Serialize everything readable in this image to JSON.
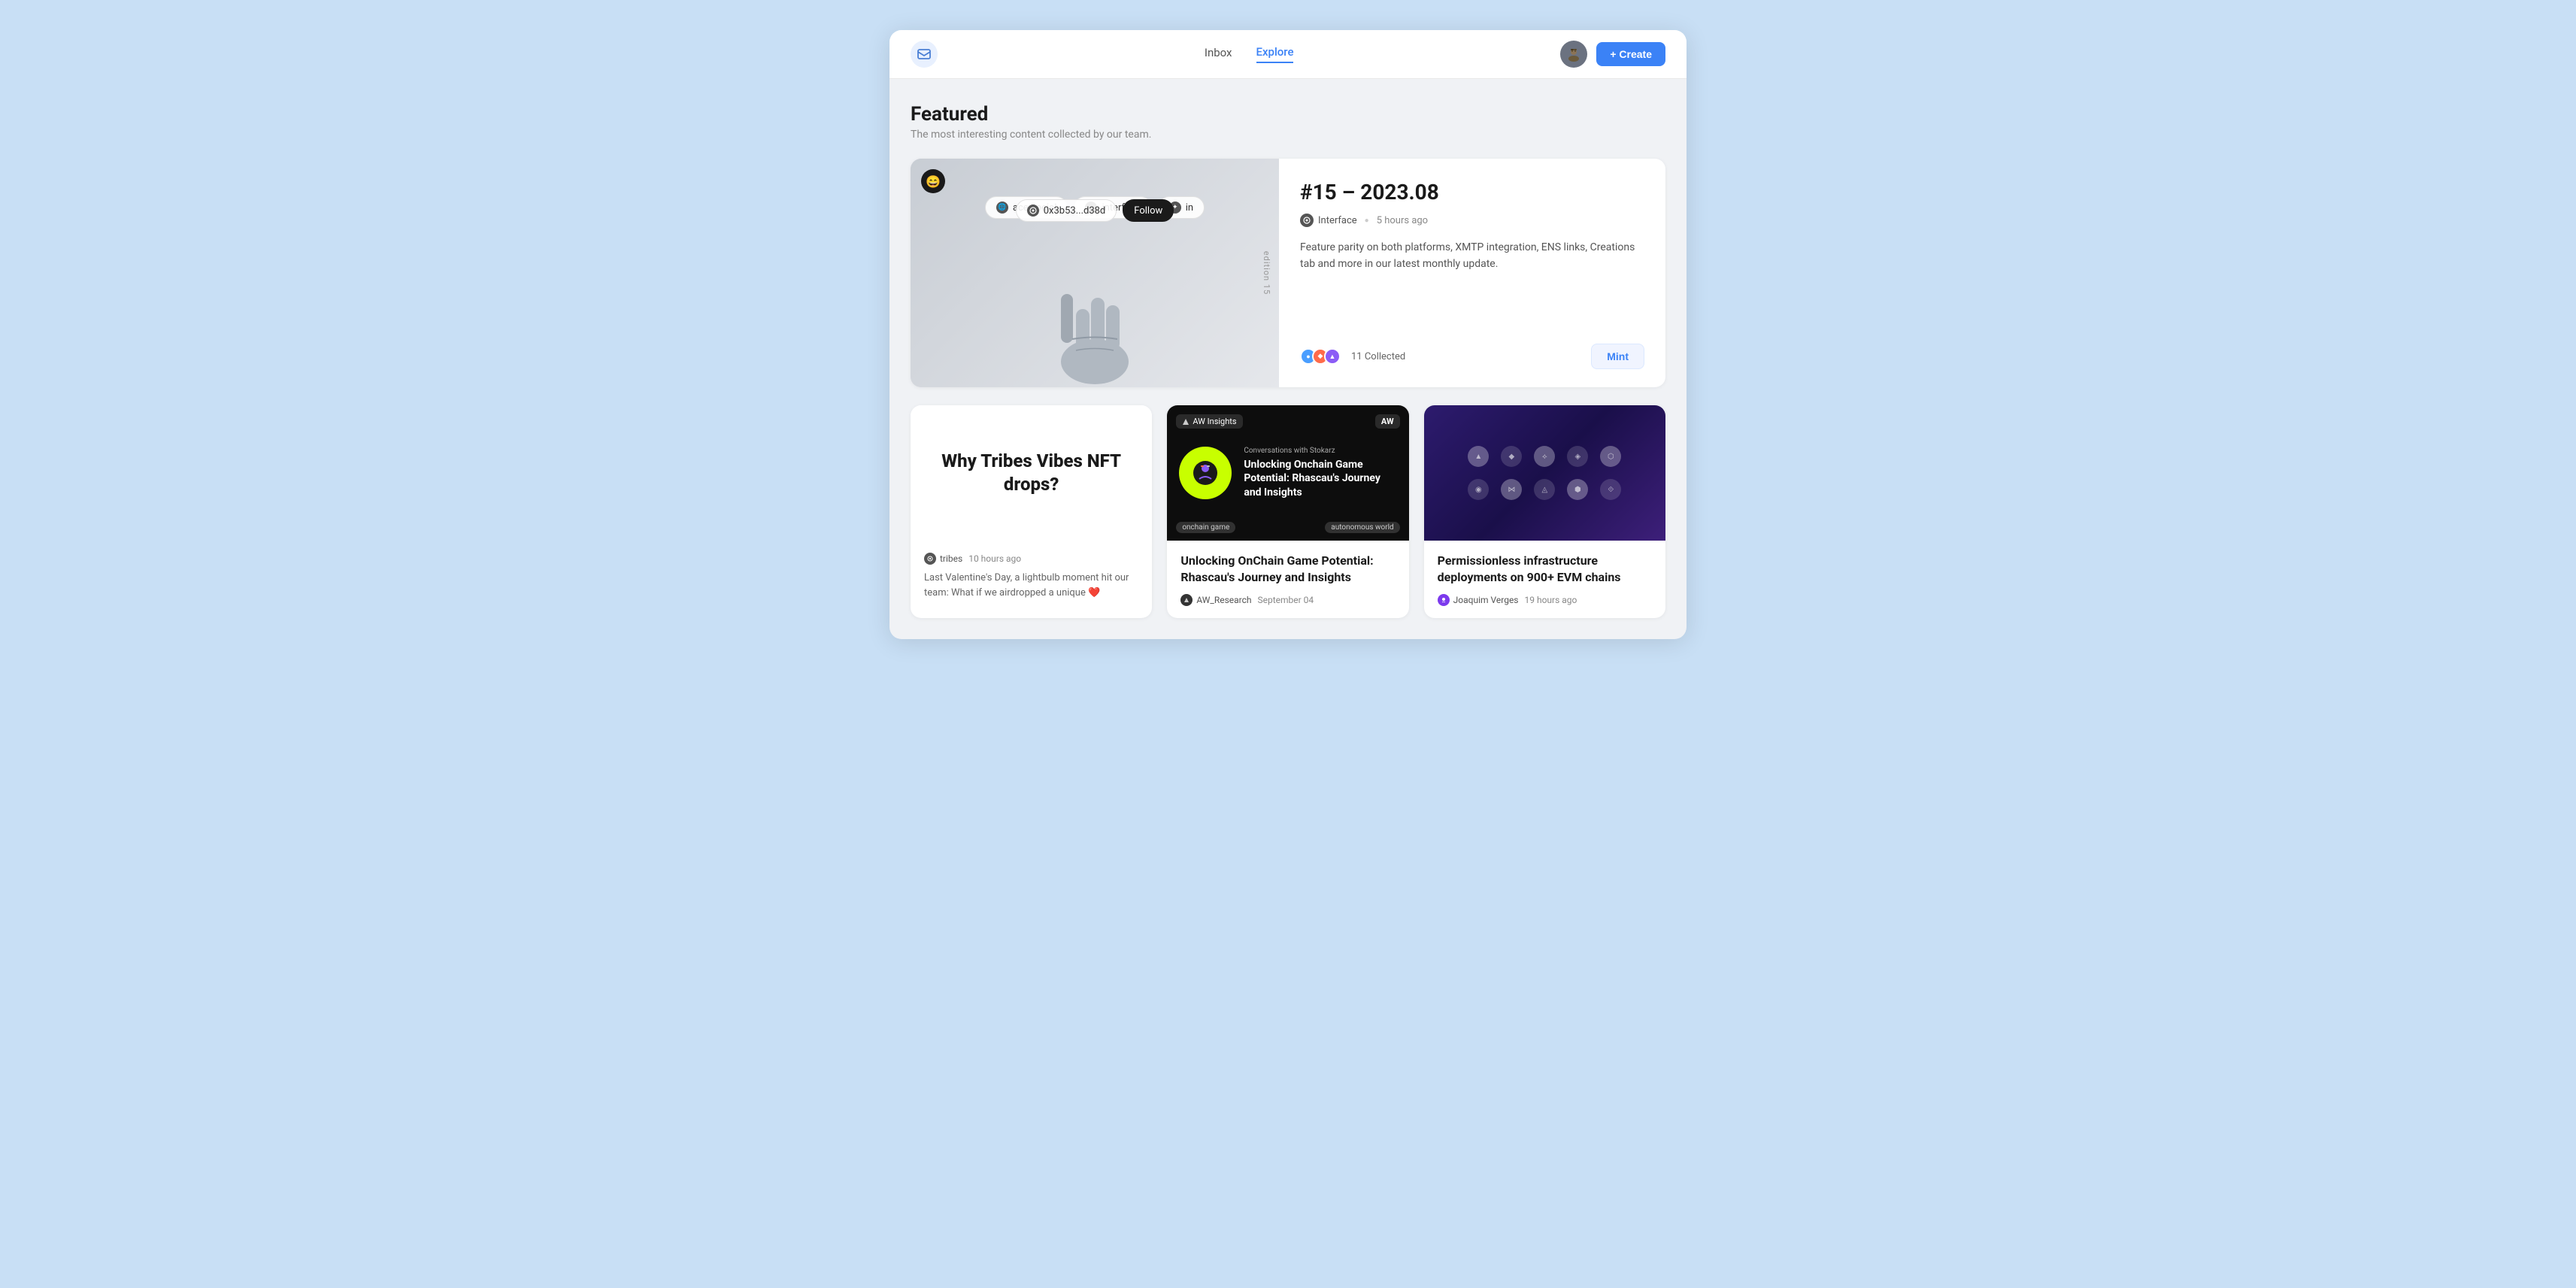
{
  "app": {
    "logo": "📬",
    "nav": {
      "inbox": "Inbox",
      "explore": "Explore"
    },
    "active_nav": "Explore",
    "create_button": "+ Create"
  },
  "featured": {
    "title": "Featured",
    "subtitle": "The most interesting content collected by our team.",
    "card": {
      "address": "0x3b53...d38d",
      "follow_button": "Follow",
      "image_pills": [
        "ace.social",
        "interface",
        "in"
      ],
      "article_title": "#15 – 2023.08",
      "source": "Interface",
      "time_ago": "5 hours ago",
      "description": "Feature parity on both platforms, XMTP integration, ENS links, Creations tab and more in our latest monthly update.",
      "collectors_count": "11 Collected",
      "mint_button": "Mint",
      "edition_label": "edition 15"
    }
  },
  "cards": [
    {
      "id": "tribes",
      "title": "Why Tribes Vibes NFT drops?",
      "source": "tribes",
      "time": "10 hours ago",
      "description": "Last Valentine's Day, a lightbulb moment hit our team: What if we airdropped a unique ❤️"
    },
    {
      "id": "aw",
      "image_badge_left": "AW Insights",
      "image_badge_right": "AW",
      "conversations_label": "Conversations with Stokarz",
      "image_heading": "Unlocking Onchain Game Potential: Rhascau's Journey and Insights",
      "image_name": "Stokarz",
      "bottom_label_left": "onchain game",
      "bottom_label_right": "autonomous world",
      "title": "Unlocking OnChain Game Potential: Rhascau's Journey and Insights",
      "source": "AW_Research",
      "time": "September 04",
      "description": ""
    },
    {
      "id": "infra",
      "title": "Permissionless infrastructure deployments on 900+ EVM chains",
      "source": "Joaquim Verges",
      "time": "19 hours ago",
      "description": ""
    }
  ]
}
